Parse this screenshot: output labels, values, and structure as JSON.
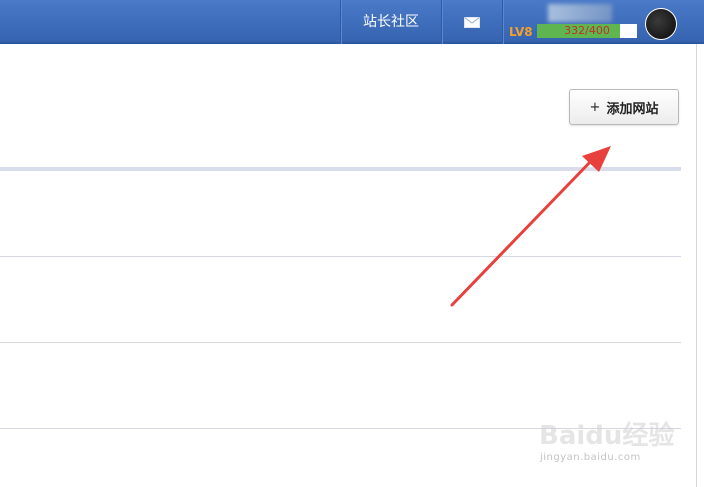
{
  "topbar": {
    "community_label": "站长社区",
    "mail_icon": "mail-icon",
    "level": {
      "label": "LV8",
      "progress_text": "332/400",
      "progress_fraction": 0.83
    },
    "avatar_icon": "user-avatar"
  },
  "main": {
    "add_site_icon": "+",
    "add_site_label": "添加网站"
  },
  "colors": {
    "topbar": "#3c6bbb",
    "level_label": "#f5a02a",
    "progress_fill": "#5fb550",
    "arrow": "#e8403c"
  },
  "watermark": {
    "logo_text": "Baidu经验",
    "url": "jingyan.baidu.com"
  }
}
